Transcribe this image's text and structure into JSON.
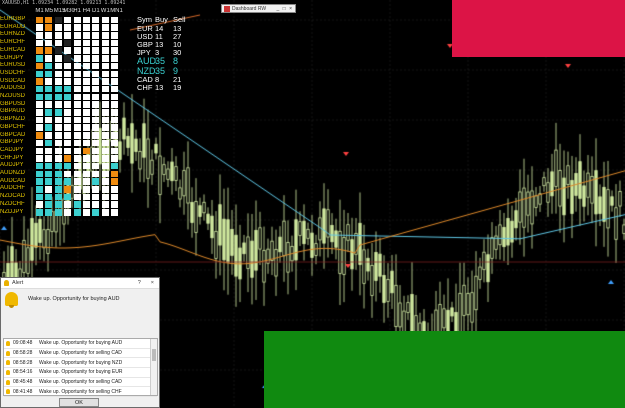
{
  "window": {
    "symbol_bar": "XAUUSD,H1 1.09234 1.09282 1.09213 1.09241",
    "dashboard_title": "Dashboard RW",
    "dashboard_controls": "_ □ ×"
  },
  "dashboard": {
    "timeframes": [
      "M1",
      "M5",
      "M15",
      "M30",
      "H1",
      "H4",
      "D1",
      "W1",
      "MN1"
    ],
    "pairs": [
      "EURGBP",
      "EURAUD",
      "EURNZD",
      "EURCHF",
      "EURCAD",
      "EURJPY",
      "EURUSD",
      "USDCHF",
      "USDCAD",
      "AUDUSD",
      "NZDUSD",
      "GBPUSD",
      "GBPAUD",
      "GBPNZD",
      "GBPCHF",
      "GBPCAD",
      "GBPJPY",
      "CADJPY",
      "CHFJPY",
      "AUDJPY",
      "AUDNZD",
      "AUDCAD",
      "AUDCHF",
      "NZDCAD",
      "NZDCHF",
      "NZDJPY"
    ],
    "cells": [
      "ooxwwwwww",
      "wowwwwwww",
      "wwwwwwwww",
      "wwwxwwwww",
      "ooxwwwwww",
      "cwwxwwwww",
      "ocwwwwwww",
      "ccwwwwwww",
      "owwwwwwww",
      "ccccwwwww",
      "ccccwwwww",
      "wwwwwwwww",
      "wccwwwwww",
      "wwwwwwwww",
      "wcwwwwwww",
      "owwwwwwww",
      "wcwwwwwww",
      "wwwwwowww",
      "wwwowwwww",
      "ccccwwwwc",
      "cccwwwwwo",
      "ccccwwcwo",
      "cwcowwwww",
      "ccccwwwww",
      "wccwcwwww",
      "cccwcwcww"
    ],
    "colors": {
      "cyan": "#3ccfcf",
      "orange": "#f08c10",
      "white": "#ffffff"
    }
  },
  "summary": {
    "headers": [
      "Sym",
      "Buy",
      "Sell"
    ],
    "rows": [
      {
        "sym": "EUR",
        "buy": "14",
        "sell": "13",
        "highlight": false
      },
      {
        "sym": "USD",
        "buy": "11",
        "sell": "27",
        "highlight": false
      },
      {
        "sym": "GBP",
        "buy": "13",
        "sell": "10",
        "highlight": false
      },
      {
        "sym": "JPY",
        "buy": "3",
        "sell": "30",
        "highlight": false
      },
      {
        "sym": "AUD",
        "buy": "35",
        "sell": "8",
        "highlight": true
      },
      {
        "sym": "NZD",
        "buy": "35",
        "sell": "9",
        "highlight": true
      },
      {
        "sym": "CAD",
        "buy": "8",
        "sell": "21",
        "highlight": false
      },
      {
        "sym": "CHF",
        "buy": "13",
        "sell": "19",
        "highlight": false
      }
    ]
  },
  "alert": {
    "title": "Alert",
    "title_help": "?",
    "title_close": "×",
    "message": "Wake up. Opportunity for buying AUD",
    "log": [
      {
        "time": "09:08:48",
        "text": "Wake up. Opportunity for buying AUD"
      },
      {
        "time": "08:58:28",
        "text": "Wake up. Opportunity for selling CAD"
      },
      {
        "time": "08:58:28",
        "text": "Wake up. Opportunity for buying NZD"
      },
      {
        "time": "08:54:16",
        "text": "Wake up. Opportunity for buying EUR"
      },
      {
        "time": "08:45:48",
        "text": "Wake up. Opportunity for selling CAD"
      },
      {
        "time": "08:41:48",
        "text": "Wake up. Opportunity for selling CHF"
      }
    ],
    "ok_label": "OK"
  },
  "zones": {
    "supply_color": "#dc1446",
    "demand_color": "#108a10"
  }
}
